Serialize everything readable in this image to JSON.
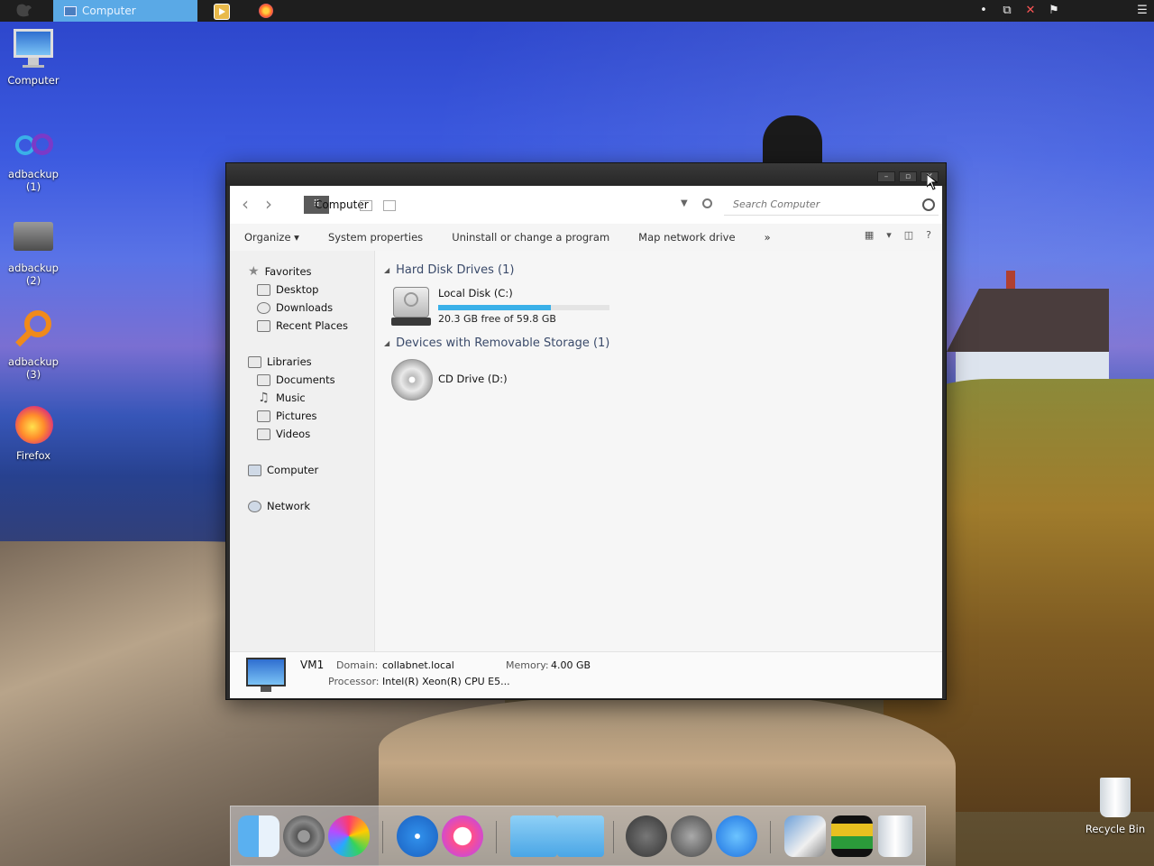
{
  "taskbar": {
    "active_task": "Computer",
    "apps": [
      "media-player-icon",
      "firefox-icon"
    ],
    "tray_icons": [
      "dot-icon",
      "network-icon",
      "volume-muted-icon",
      "flag-icon",
      "menu-icon"
    ]
  },
  "desktop": {
    "icons": [
      {
        "label": "Computer",
        "icon": "computer-icon"
      },
      {
        "label": "adbackup (1)",
        "icon": "adbackup-icon"
      },
      {
        "label": "adbackup (2)",
        "icon": "drive-icon"
      },
      {
        "label": "adbackup (3)",
        "icon": "search-icon"
      },
      {
        "label": "Firefox",
        "icon": "firefox-icon"
      }
    ],
    "recycle_bin": "Recycle Bin"
  },
  "window": {
    "title": "Computer",
    "controls": {
      "minimize": "–",
      "maximize": "▫",
      "close": "✕"
    },
    "address": {
      "segment": "⠿",
      "text": "Computer"
    },
    "search_placeholder": "Search Computer",
    "commands": [
      "Organize ▾",
      "System properties",
      "Uninstall or change a program",
      "Map network drive",
      "»"
    ],
    "sidebar": {
      "favorites": {
        "label": "Favorites",
        "items": [
          "Desktop",
          "Downloads",
          "Recent Places"
        ]
      },
      "libraries": {
        "label": "Libraries",
        "items": [
          "Documents",
          "Music",
          "Pictures",
          "Videos"
        ]
      },
      "computer": "Computer",
      "network": "Network"
    },
    "groups": [
      {
        "title": "Hard Disk Drives (1)",
        "drives": [
          {
            "name": "Local Disk (C:)",
            "free": "20.3 GB free of 59.8 GB",
            "used_fraction": 0.66
          }
        ]
      },
      {
        "title": "Devices with Removable Storage (1)",
        "drives": [
          {
            "name": "CD Drive (D:)"
          }
        ]
      }
    ],
    "details": {
      "name": "VM1",
      "domain_label": "Domain:",
      "domain": "collabnet.local",
      "memory_label": "Memory:",
      "memory": "4.00 GB",
      "processor_label": "Processor:",
      "processor": "Intel(R) Xeon(R) CPU E5..."
    }
  },
  "dock": {
    "items": [
      "finder-icon",
      "system-preferences-icon",
      "game-center-icon",
      "safari-icon",
      "itunes-icon",
      "folder-icon",
      "applications-folder-icon",
      "power-icon",
      "launchpad-icon",
      "app-store-icon",
      "preview-icon",
      "photo-booth-icon",
      "trash-icon"
    ]
  },
  "colors": {
    "accent": "#5aa9e6",
    "progress": "#3ab0e8",
    "taskbar": "#1e1e1e"
  }
}
